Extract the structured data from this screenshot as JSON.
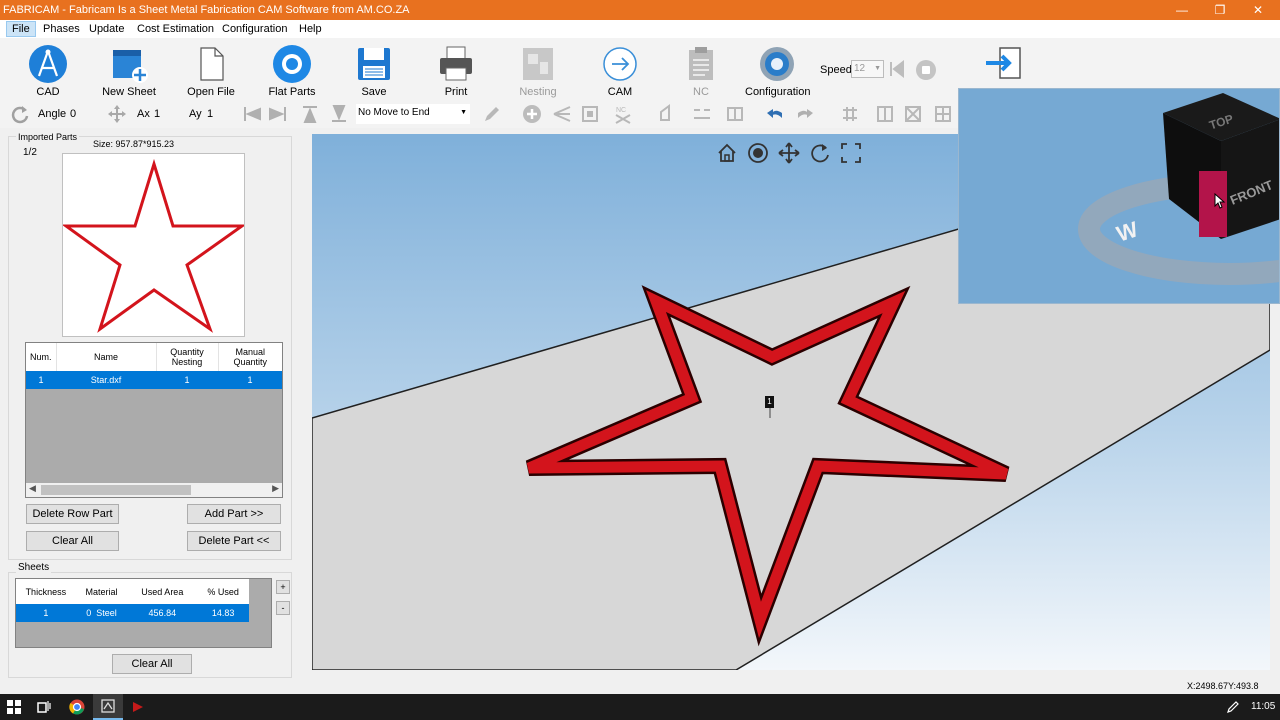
{
  "window": {
    "title": "FABRICAM - Fabricam Is a Sheet Metal Fabrication CAM Software from AM.CO.ZA"
  },
  "menu": [
    "File",
    "Phases",
    "Update",
    "Cost Estimation",
    "Configuration",
    "Help"
  ],
  "ribbon": {
    "cad": "CAD",
    "new_sheet": "New Sheet",
    "open_file": "Open File",
    "flat_parts": "Flat Parts",
    "save": "Save",
    "print": "Print",
    "nesting": "Nesting",
    "cam": "CAM",
    "nc": "NC",
    "configuration": "Configuration",
    "speed_label": "Speed",
    "speed_value": "12"
  },
  "toolbar2": {
    "angle_label": "Angle",
    "angle_value": "0",
    "ax_label": "Ax",
    "ax_value": "1",
    "ay_label": "Ay",
    "ay_value": "1",
    "move_select": "No Move to End"
  },
  "imported_parts": {
    "group_label": "Imported Parts",
    "page": "1/2",
    "size": "Size: 957.87*915.23",
    "columns": [
      "Num.",
      "Name",
      "Quantity Nesting",
      "Manual Quantity"
    ],
    "rows": [
      {
        "num": "1",
        "name": "Star.dxf",
        "qty_nesting": "1",
        "manual_qty": "1"
      }
    ],
    "delete_row_button": "Delete Row Part",
    "add_part_button": "Add Part >>",
    "clear_all_button": "Clear All",
    "delete_part_button": "Delete Part <<"
  },
  "sheets": {
    "group_label": "Sheets",
    "columns": [
      "Thickness",
      "Material",
      "Used Area",
      "% Used"
    ],
    "rows": [
      {
        "thickness": "1",
        "material": "0  Steel",
        "used_area": "456.84",
        "pct_used": "14.83"
      }
    ],
    "plus": "+",
    "minus": "-",
    "clear_all_button": "Clear All"
  },
  "viewport": {
    "part_label": "1",
    "cube_faces": {
      "top": "TOP",
      "front": "FRONT",
      "compass_w": "W"
    }
  },
  "status": {
    "coords": "X:2498.67Y:493.8"
  },
  "taskbar": {
    "time": "11:05"
  },
  "colors": {
    "title_bar": "#e8711f",
    "star_outline": "#d3141c",
    "selection": "#0078d7",
    "sheet_gray": "#d7d7d7",
    "sky_top": "#7fb0da"
  }
}
